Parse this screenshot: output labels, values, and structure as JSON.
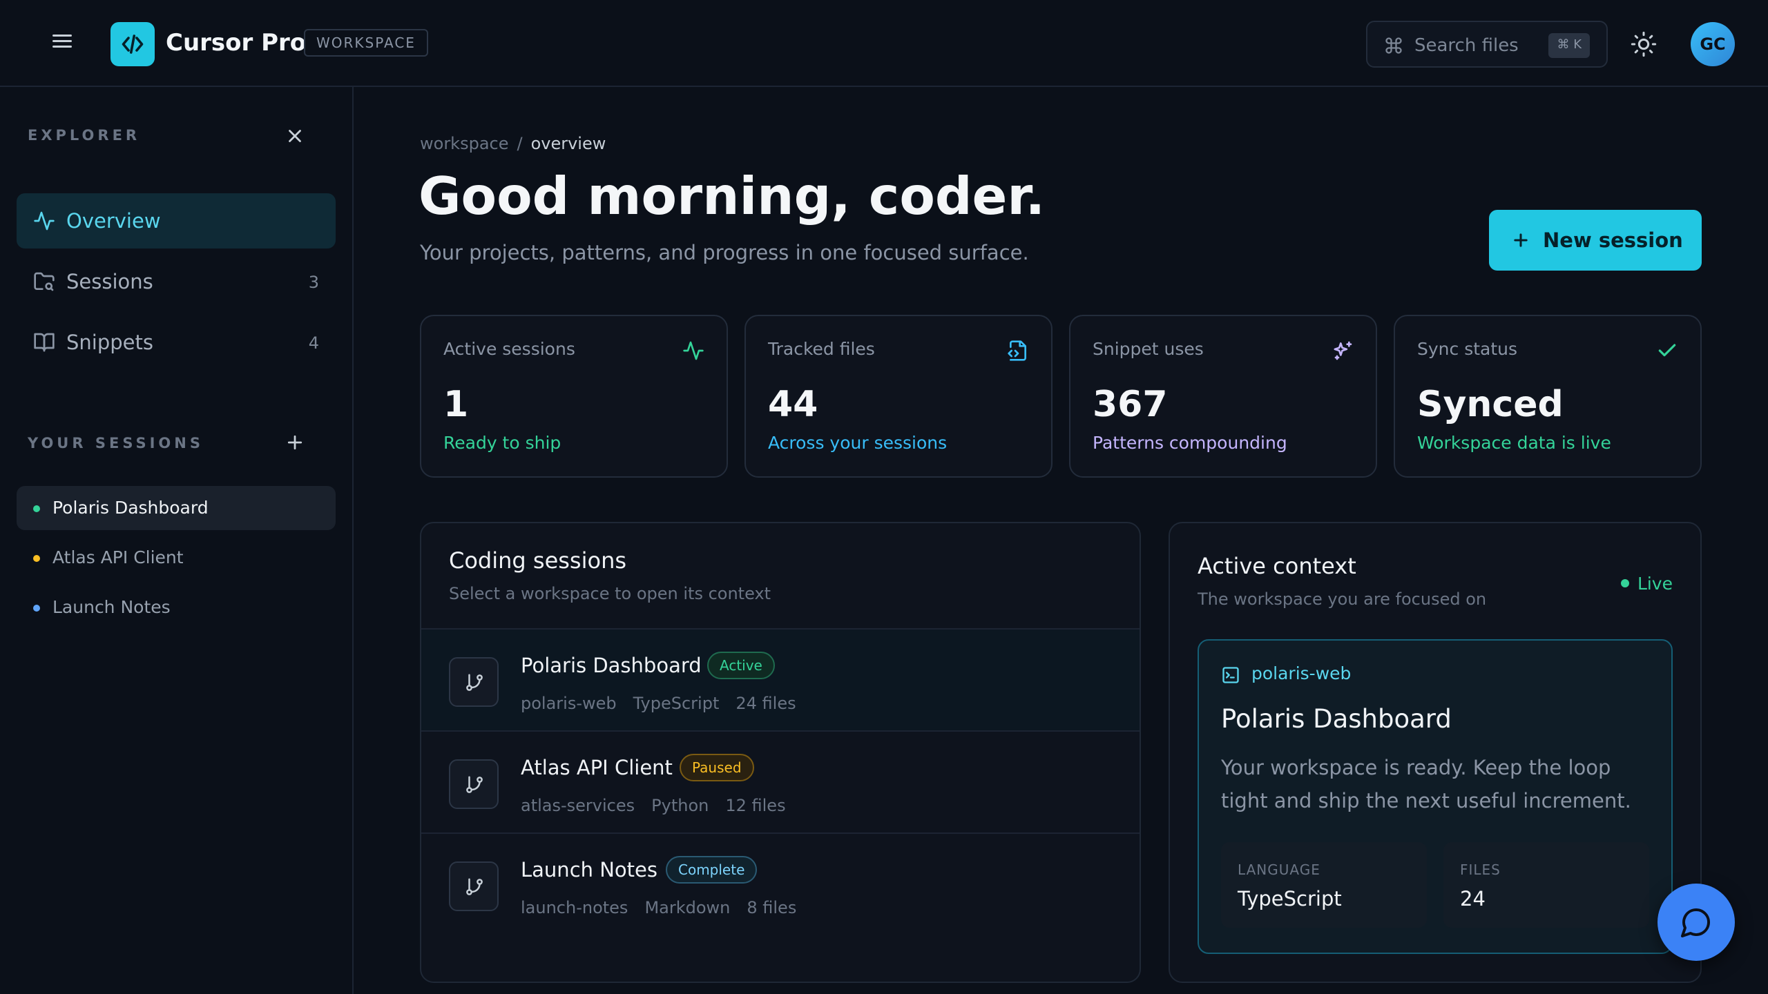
{
  "header": {
    "app_title": "Cursor Pro",
    "workspace_badge": "WORKSPACE",
    "search_placeholder": "Search files",
    "search_shortcut": "⌘ K",
    "avatar_initials": "GC"
  },
  "sidebar": {
    "explorer_label": "EXPLORER",
    "nav": [
      {
        "label": "Overview",
        "count": "",
        "icon": "activity-icon",
        "active": true
      },
      {
        "label": "Sessions",
        "count": "3",
        "icon": "folder-search-icon",
        "active": false
      },
      {
        "label": "Snippets",
        "count": "4",
        "icon": "book-open-icon",
        "active": false
      }
    ],
    "sessions_label": "YOUR SESSIONS",
    "sessions": [
      {
        "label": "Polaris Dashboard",
        "dot_color": "#34d399",
        "active": true
      },
      {
        "label": "Atlas API Client",
        "dot_color": "#fbbf24",
        "active": false
      },
      {
        "label": "Launch Notes",
        "dot_color": "#60a5fa",
        "active": false
      }
    ]
  },
  "main": {
    "breadcrumb": {
      "root": "workspace",
      "separator": "/",
      "current": "overview"
    },
    "greeting": "Good morning, coder.",
    "subtitle": "Your projects, patterns, and progress in one focused surface.",
    "new_session_label": "New session",
    "stats": [
      {
        "title": "Active sessions",
        "value": "1",
        "sub": "Ready to ship",
        "sub_color": "#34d399",
        "icon": "activity-icon"
      },
      {
        "title": "Tracked files",
        "value": "44",
        "sub": "Across your sessions",
        "sub_color": "#38bdf8",
        "icon": "file-code-icon"
      },
      {
        "title": "Snippet uses",
        "value": "367",
        "sub": "Patterns compounding",
        "sub_color": "#c4b5fd",
        "icon": "sparkles-icon"
      },
      {
        "title": "Sync status",
        "value": "Synced",
        "sub": "Workspace data is live",
        "sub_color": "#34d399",
        "icon": "check-icon"
      }
    ],
    "coding_sessions": {
      "title": "Coding sessions",
      "subtitle": "Select a workspace to open its context",
      "rows": [
        {
          "name": "Polaris Dashboard",
          "badge": "Active",
          "repo": "polaris-web",
          "language": "TypeScript",
          "files": "24 files",
          "active": true
        },
        {
          "name": "Atlas API Client",
          "badge": "Paused",
          "repo": "atlas-services",
          "language": "Python",
          "files": "12 files",
          "active": false
        },
        {
          "name": "Launch Notes",
          "badge": "Complete",
          "repo": "launch-notes",
          "language": "Markdown",
          "files": "8 files",
          "active": false
        }
      ]
    },
    "active_context": {
      "title": "Active context",
      "subtitle": "The workspace you are focused on",
      "live_label": "Live",
      "repo": "polaris-web",
      "name": "Polaris Dashboard",
      "description": "Your workspace is ready. Keep the loop tight and ship the next useful increment.",
      "language_label": "LANGUAGE",
      "language_value": "TypeScript",
      "files_label": "FILES",
      "files_value": "24"
    }
  },
  "colors": {
    "accent": "#22c7e2",
    "background": "#0b1019",
    "active_badge": "#34d399",
    "paused_badge": "#fbbf24",
    "complete_badge": "#7dd3fc"
  }
}
